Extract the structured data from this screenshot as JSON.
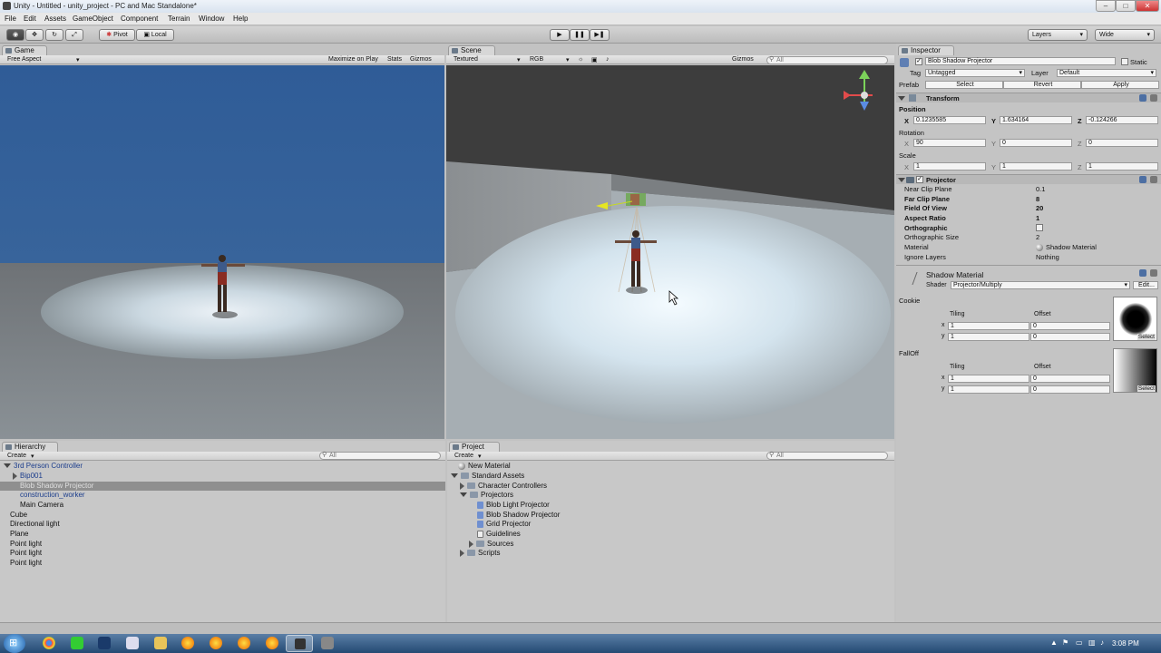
{
  "window": {
    "title": "Unity - Untitled - unity_project - PC and Mac Standalone*",
    "minimize": "–",
    "maximize": "□",
    "close": "✕"
  },
  "menu": [
    "File",
    "Edit",
    "Assets",
    "GameObject",
    "Component",
    "Terrain",
    "Window",
    "Help"
  ],
  "toolbar": {
    "pivot": "Pivot",
    "local": "Local",
    "layers": "Layers",
    "layout": "Wide"
  },
  "game": {
    "tab": "Game",
    "aspect": "Free Aspect",
    "maximize": "Maximize on Play",
    "stats": "Stats",
    "gizmos": "Gizmos"
  },
  "scene": {
    "tab": "Scene",
    "mode": "Textured",
    "color": "RGB",
    "gizmos": "Gizmos",
    "search": "All"
  },
  "hierarchy": {
    "tab": "Hierarchy",
    "create": "Create",
    "search": "All",
    "items": [
      "3rd Person Controller",
      "Bip001",
      "Blob Shadow Projector",
      "construction_worker",
      "Main Camera",
      "Cube",
      "Directional light",
      "Plane",
      "Point light",
      "Point light",
      "Point light"
    ]
  },
  "project": {
    "tab": "Project",
    "create": "Create",
    "search": "All",
    "items": [
      "New Material",
      "Standard Assets",
      "Character Controllers",
      "Projectors",
      "Blob Light Projector",
      "Blob Shadow Projector",
      "Grid Projector",
      "Guidelines",
      "Sources",
      "Scripts"
    ]
  },
  "inspector": {
    "tab": "Inspector",
    "object_name": "Blob Shadow Projector",
    "static": "Static",
    "tag_label": "Tag",
    "tag_value": "Untagged",
    "layer_label": "Layer",
    "layer_value": "Default",
    "prefab_label": "Prefab",
    "prefab_select": "Select",
    "prefab_revert": "Revert",
    "prefab_apply": "Apply",
    "transform": {
      "title": "Transform",
      "position_label": "Position",
      "position": {
        "x": "0.1235585",
        "y": "1.634164",
        "z": "-0.124266"
      },
      "rotation_label": "Rotation",
      "rotation": {
        "x": "90",
        "y": "0",
        "z": "0"
      },
      "scale_label": "Scale",
      "scale": {
        "x": "1",
        "y": "1",
        "z": "1"
      }
    },
    "projector": {
      "title": "Projector",
      "rows": [
        {
          "label": "Near Clip Plane",
          "value": "0.1"
        },
        {
          "label": "Far Clip Plane",
          "value": "8"
        },
        {
          "label": "Field Of View",
          "value": "20"
        },
        {
          "label": "Aspect Ratio",
          "value": "1"
        },
        {
          "label": "Orthographic",
          "value": ""
        },
        {
          "label": "Orthographic Size",
          "value": "2"
        },
        {
          "label": "Material",
          "value": "Shadow Material"
        },
        {
          "label": "Ignore Layers",
          "value": "Nothing"
        }
      ]
    },
    "material": {
      "name": "Shadow Material",
      "shader_label": "Shader",
      "shader_value": "Projector/Multiply",
      "edit": "Edit...",
      "cookie": "Cookie",
      "falloff": "FallOff",
      "tiling": "Tiling",
      "offset": "Offset",
      "x": "x",
      "y": "y",
      "cookie_tiling": {
        "x": "1",
        "y": "1"
      },
      "cookie_offset": {
        "x": "0",
        "y": "0"
      },
      "falloff_tiling": {
        "x": "1",
        "y": "1"
      },
      "falloff_offset": {
        "x": "0",
        "y": "0"
      },
      "select": "Select"
    }
  },
  "clock": "3:08 PM"
}
